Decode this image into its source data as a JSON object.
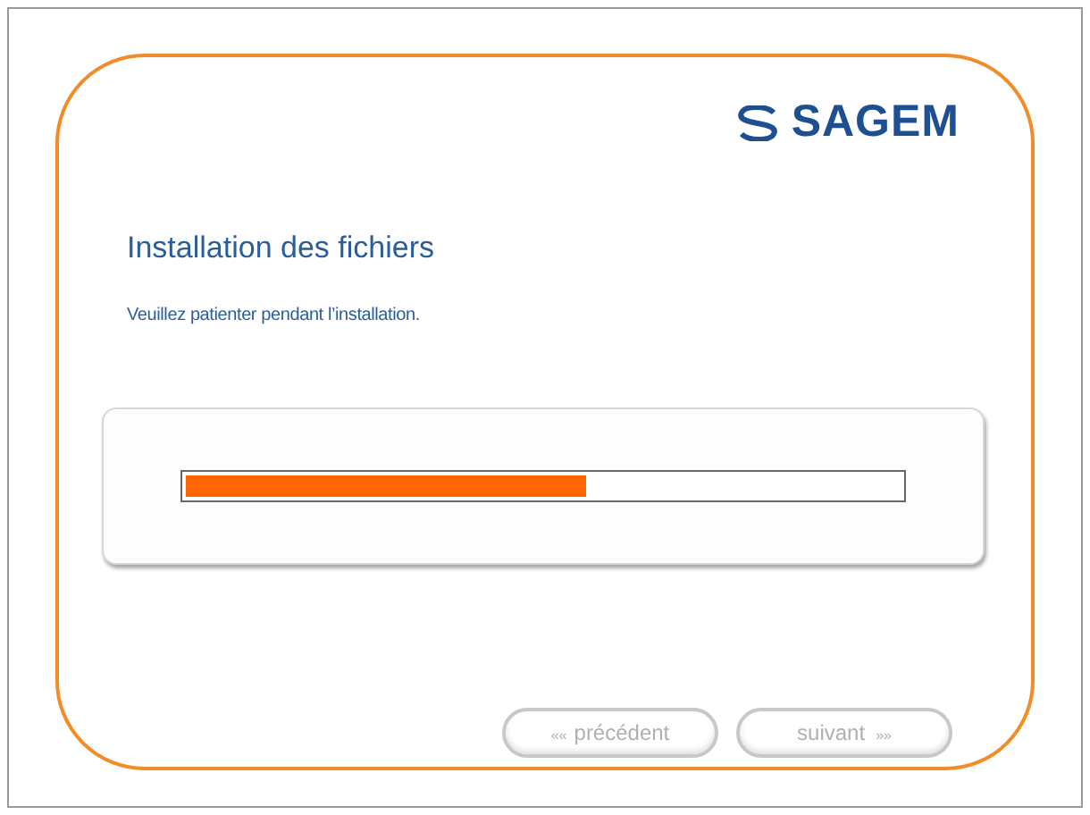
{
  "logo": {
    "text": "SAGEM"
  },
  "title": "Installation des fichiers",
  "subtitle": "Veuillez patienter pendant l’installation.",
  "progress": {
    "level": 0.56
  },
  "buttons": [
    {
      "label": "précédent",
      "arrow": "««",
      "kind": "back",
      "disabled": true
    },
    {
      "label": "suivant",
      "arrow": "»»",
      "kind": "forward",
      "disabled": true
    }
  ]
}
